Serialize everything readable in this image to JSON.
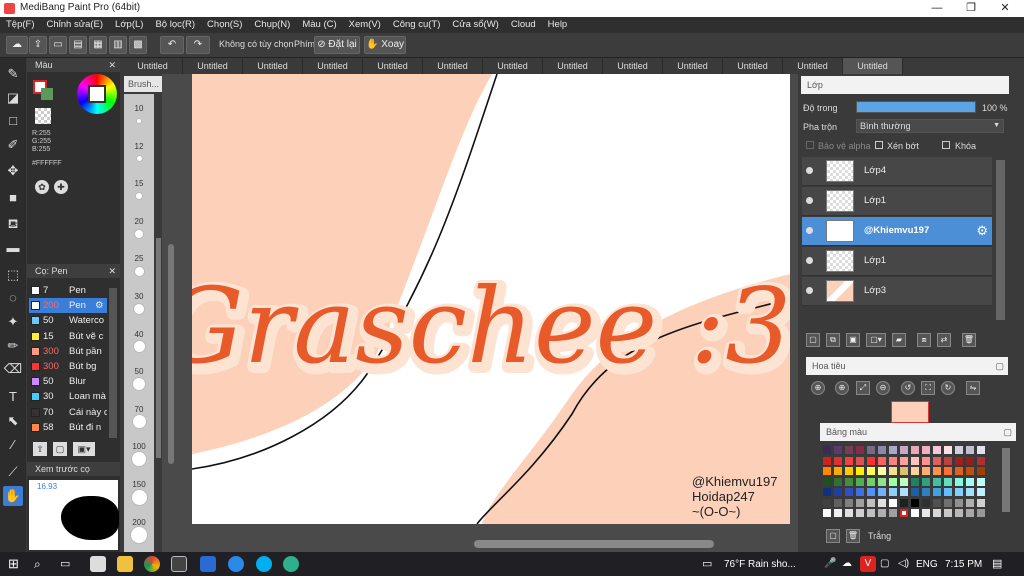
{
  "app": {
    "title": "MediBang Paint Pro (64bit)"
  },
  "menu": [
    "Tệp(F)",
    "Chỉnh sửa(E)",
    "Lớp(L)",
    "Bộ lọc(R)",
    "Chọn(S)",
    "Chụp(N)",
    "Màu (C)",
    "Xem(V)",
    "Công cụ(T)",
    "Cửa sổ(W)",
    "Cloud",
    "Help"
  ],
  "toolbar": {
    "no_option": "Không có tùy chọn",
    "key_label": "Phím",
    "reset_label": "Đặt lại",
    "rotate_label": "Xoay"
  },
  "color_panel": {
    "title": "Màu",
    "r": "R:255",
    "g": "G:255",
    "b": "B:255",
    "hex": "#FFFFFF"
  },
  "brush_panel": {
    "title": "Cọ: Pen",
    "items": [
      {
        "size": "7",
        "name": "Pen",
        "color": "#ffffff",
        "size_color": "#eeeeee"
      },
      {
        "size": "200",
        "name": "Pen",
        "color": "#ffffff",
        "size_color": "#ff6666",
        "selected": true
      },
      {
        "size": "50",
        "name": "Waterco",
        "color": "#66ccff",
        "size_color": "#eeeeee"
      },
      {
        "size": "15",
        "name": "Bút vẽ c",
        "color": "#ffee33",
        "size_color": "#eeeeee"
      },
      {
        "size": "300",
        "name": "Bút pần",
        "color": "#ff9988",
        "size_color": "#ff6666"
      },
      {
        "size": "300",
        "name": "Bút bg",
        "color": "#ff3333",
        "size_color": "#ff6666"
      },
      {
        "size": "50",
        "name": "Blur",
        "color": "#cc88ff",
        "size_color": "#eeeeee"
      },
      {
        "size": "30",
        "name": "Loan mà",
        "color": "#44ccff",
        "size_color": "#eeeeee"
      },
      {
        "size": "70",
        "name": "Cái này c",
        "color": "#333333",
        "size_color": "#eeeeee"
      },
      {
        "size": "58",
        "name": "Bút đi n",
        "color": "#ff8844",
        "size_color": "#eeeeee"
      }
    ]
  },
  "preview": {
    "title": "Xem trước cọ",
    "zoom": "16.93"
  },
  "brush_sizes": {
    "title": "Brush...",
    "labels": [
      "10",
      "12",
      "15",
      "20",
      "25",
      "30",
      "40",
      "50",
      "70",
      "100",
      "150",
      "200"
    ]
  },
  "tabs": [
    "Untitled",
    "Untitled",
    "Untitled",
    "Untitled",
    "Untitled",
    "Untitled",
    "Untitled",
    "Untitled",
    "Untitled",
    "Untitled",
    "Untitled",
    "Untitled",
    "Untitled"
  ],
  "canvas": {
    "main_text": "Graschee :3",
    "credit": [
      "@Khiemvu197",
      "Hoidap247",
      "~(O-O~)"
    ]
  },
  "layers": {
    "title": "Lớp",
    "opacity_label": "Độ trong",
    "opacity_value": "100 %",
    "opacity": 1.0,
    "blend_label": "Pha trộn",
    "blend_value": "Bình thường",
    "protect_alpha": "Bảo vệ alpha",
    "clipping": "Xén bớt",
    "lock": "Khóa",
    "items": [
      {
        "name": "Lớp4",
        "selected": false
      },
      {
        "name": "Lớp1",
        "selected": false
      },
      {
        "name": "@Khiemvu197",
        "selected": true
      },
      {
        "name": "Lớp1",
        "selected": false
      },
      {
        "name": "Lớp3",
        "selected": false
      }
    ]
  },
  "navigator": {
    "title": "Hoa tiêu"
  },
  "palette": {
    "title": "Bảng màu",
    "current": "Trắng"
  },
  "taskbar": {
    "weather": "76°F Rain sho...",
    "lang": "ENG",
    "time": "7:15 PM"
  }
}
